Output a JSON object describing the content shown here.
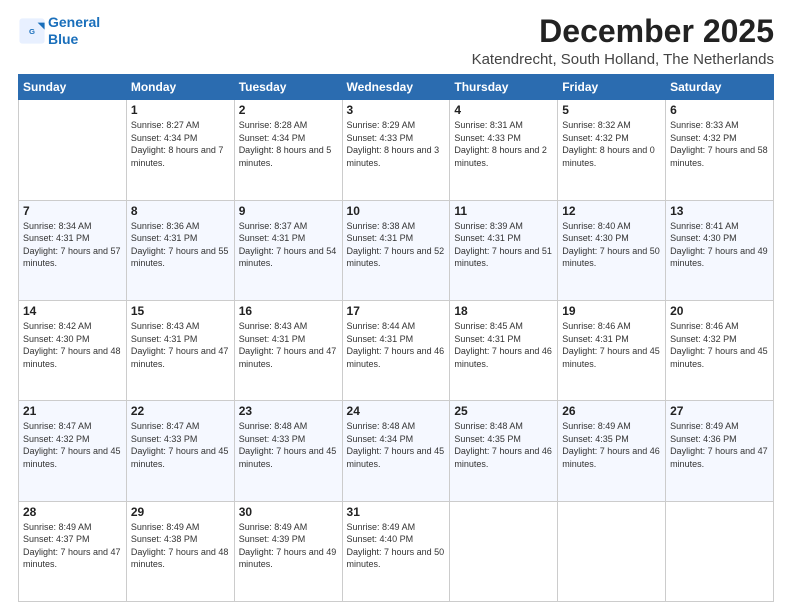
{
  "logo": {
    "line1": "General",
    "line2": "Blue"
  },
  "title": "December 2025",
  "subtitle": "Katendrecht, South Holland, The Netherlands",
  "weekdays": [
    "Sunday",
    "Monday",
    "Tuesday",
    "Wednesday",
    "Thursday",
    "Friday",
    "Saturday"
  ],
  "weeks": [
    [
      {
        "day": "",
        "sunrise": "",
        "sunset": "",
        "daylight": ""
      },
      {
        "day": "1",
        "sunrise": "Sunrise: 8:27 AM",
        "sunset": "Sunset: 4:34 PM",
        "daylight": "Daylight: 8 hours and 7 minutes."
      },
      {
        "day": "2",
        "sunrise": "Sunrise: 8:28 AM",
        "sunset": "Sunset: 4:34 PM",
        "daylight": "Daylight: 8 hours and 5 minutes."
      },
      {
        "day": "3",
        "sunrise": "Sunrise: 8:29 AM",
        "sunset": "Sunset: 4:33 PM",
        "daylight": "Daylight: 8 hours and 3 minutes."
      },
      {
        "day": "4",
        "sunrise": "Sunrise: 8:31 AM",
        "sunset": "Sunset: 4:33 PM",
        "daylight": "Daylight: 8 hours and 2 minutes."
      },
      {
        "day": "5",
        "sunrise": "Sunrise: 8:32 AM",
        "sunset": "Sunset: 4:32 PM",
        "daylight": "Daylight: 8 hours and 0 minutes."
      },
      {
        "day": "6",
        "sunrise": "Sunrise: 8:33 AM",
        "sunset": "Sunset: 4:32 PM",
        "daylight": "Daylight: 7 hours and 58 minutes."
      }
    ],
    [
      {
        "day": "7",
        "sunrise": "Sunrise: 8:34 AM",
        "sunset": "Sunset: 4:31 PM",
        "daylight": "Daylight: 7 hours and 57 minutes."
      },
      {
        "day": "8",
        "sunrise": "Sunrise: 8:36 AM",
        "sunset": "Sunset: 4:31 PM",
        "daylight": "Daylight: 7 hours and 55 minutes."
      },
      {
        "day": "9",
        "sunrise": "Sunrise: 8:37 AM",
        "sunset": "Sunset: 4:31 PM",
        "daylight": "Daylight: 7 hours and 54 minutes."
      },
      {
        "day": "10",
        "sunrise": "Sunrise: 8:38 AM",
        "sunset": "Sunset: 4:31 PM",
        "daylight": "Daylight: 7 hours and 52 minutes."
      },
      {
        "day": "11",
        "sunrise": "Sunrise: 8:39 AM",
        "sunset": "Sunset: 4:31 PM",
        "daylight": "Daylight: 7 hours and 51 minutes."
      },
      {
        "day": "12",
        "sunrise": "Sunrise: 8:40 AM",
        "sunset": "Sunset: 4:30 PM",
        "daylight": "Daylight: 7 hours and 50 minutes."
      },
      {
        "day": "13",
        "sunrise": "Sunrise: 8:41 AM",
        "sunset": "Sunset: 4:30 PM",
        "daylight": "Daylight: 7 hours and 49 minutes."
      }
    ],
    [
      {
        "day": "14",
        "sunrise": "Sunrise: 8:42 AM",
        "sunset": "Sunset: 4:30 PM",
        "daylight": "Daylight: 7 hours and 48 minutes."
      },
      {
        "day": "15",
        "sunrise": "Sunrise: 8:43 AM",
        "sunset": "Sunset: 4:31 PM",
        "daylight": "Daylight: 7 hours and 47 minutes."
      },
      {
        "day": "16",
        "sunrise": "Sunrise: 8:43 AM",
        "sunset": "Sunset: 4:31 PM",
        "daylight": "Daylight: 7 hours and 47 minutes."
      },
      {
        "day": "17",
        "sunrise": "Sunrise: 8:44 AM",
        "sunset": "Sunset: 4:31 PM",
        "daylight": "Daylight: 7 hours and 46 minutes."
      },
      {
        "day": "18",
        "sunrise": "Sunrise: 8:45 AM",
        "sunset": "Sunset: 4:31 PM",
        "daylight": "Daylight: 7 hours and 46 minutes."
      },
      {
        "day": "19",
        "sunrise": "Sunrise: 8:46 AM",
        "sunset": "Sunset: 4:31 PM",
        "daylight": "Daylight: 7 hours and 45 minutes."
      },
      {
        "day": "20",
        "sunrise": "Sunrise: 8:46 AM",
        "sunset": "Sunset: 4:32 PM",
        "daylight": "Daylight: 7 hours and 45 minutes."
      }
    ],
    [
      {
        "day": "21",
        "sunrise": "Sunrise: 8:47 AM",
        "sunset": "Sunset: 4:32 PM",
        "daylight": "Daylight: 7 hours and 45 minutes."
      },
      {
        "day": "22",
        "sunrise": "Sunrise: 8:47 AM",
        "sunset": "Sunset: 4:33 PM",
        "daylight": "Daylight: 7 hours and 45 minutes."
      },
      {
        "day": "23",
        "sunrise": "Sunrise: 8:48 AM",
        "sunset": "Sunset: 4:33 PM",
        "daylight": "Daylight: 7 hours and 45 minutes."
      },
      {
        "day": "24",
        "sunrise": "Sunrise: 8:48 AM",
        "sunset": "Sunset: 4:34 PM",
        "daylight": "Daylight: 7 hours and 45 minutes."
      },
      {
        "day": "25",
        "sunrise": "Sunrise: 8:48 AM",
        "sunset": "Sunset: 4:35 PM",
        "daylight": "Daylight: 7 hours and 46 minutes."
      },
      {
        "day": "26",
        "sunrise": "Sunrise: 8:49 AM",
        "sunset": "Sunset: 4:35 PM",
        "daylight": "Daylight: 7 hours and 46 minutes."
      },
      {
        "day": "27",
        "sunrise": "Sunrise: 8:49 AM",
        "sunset": "Sunset: 4:36 PM",
        "daylight": "Daylight: 7 hours and 47 minutes."
      }
    ],
    [
      {
        "day": "28",
        "sunrise": "Sunrise: 8:49 AM",
        "sunset": "Sunset: 4:37 PM",
        "daylight": "Daylight: 7 hours and 47 minutes."
      },
      {
        "day": "29",
        "sunrise": "Sunrise: 8:49 AM",
        "sunset": "Sunset: 4:38 PM",
        "daylight": "Daylight: 7 hours and 48 minutes."
      },
      {
        "day": "30",
        "sunrise": "Sunrise: 8:49 AM",
        "sunset": "Sunset: 4:39 PM",
        "daylight": "Daylight: 7 hours and 49 minutes."
      },
      {
        "day": "31",
        "sunrise": "Sunrise: 8:49 AM",
        "sunset": "Sunset: 4:40 PM",
        "daylight": "Daylight: 7 hours and 50 minutes."
      },
      {
        "day": "",
        "sunrise": "",
        "sunset": "",
        "daylight": ""
      },
      {
        "day": "",
        "sunrise": "",
        "sunset": "",
        "daylight": ""
      },
      {
        "day": "",
        "sunrise": "",
        "sunset": "",
        "daylight": ""
      }
    ]
  ]
}
